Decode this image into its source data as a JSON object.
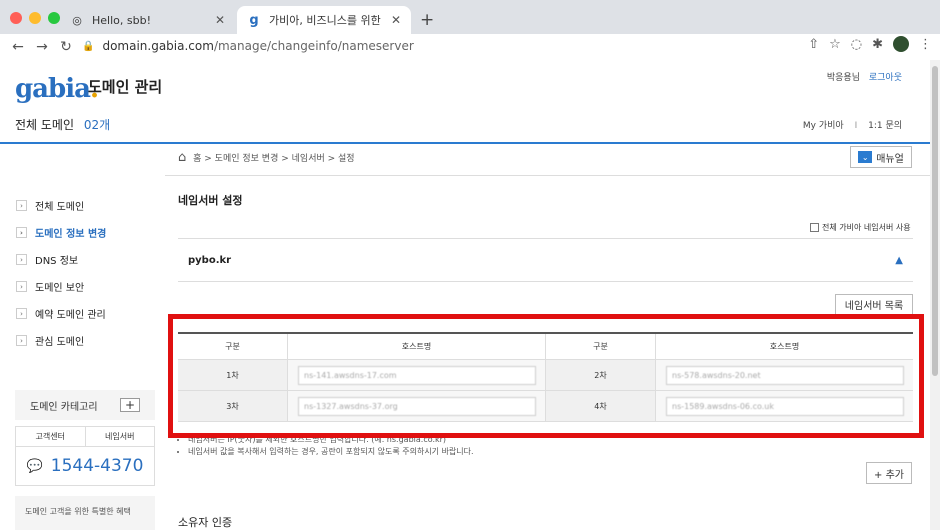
{
  "browser": {
    "tabs": [
      {
        "title": "Hello, sbb!",
        "active": false
      },
      {
        "title": "가비아, 비즈니스를 위한 IT : 도메인/",
        "active": true
      }
    ],
    "url_domain": "domain.gabia.com",
    "url_path": "/manage/changeinfo/nameserver"
  },
  "header": {
    "logo": "gabia",
    "logo_dot": ".",
    "site_title": "도메인 관리",
    "user_name": "박응용님",
    "logout": "로그아웃",
    "domains_label": "전체 도메인",
    "domains_count": "02개",
    "my_gabia": "My 가비아",
    "inquiry": "1:1 문의",
    "separator": "I"
  },
  "breadcrumb": {
    "items": "홈 > 도메인 정보 변경 > 네임서버 > 설정",
    "manual_label": "매뉴얼"
  },
  "sidebar": {
    "items": [
      {
        "label": "전체 도메인",
        "active": false
      },
      {
        "label": "도메인 정보 변경",
        "active": true
      },
      {
        "label": "DNS 정보",
        "active": false
      },
      {
        "label": "도메인 보안",
        "active": false
      },
      {
        "label": "예약 도메인 관리",
        "active": false
      },
      {
        "label": "관심 도메인",
        "active": false
      }
    ],
    "category_label": "도메인 카테고리",
    "category_add": "+",
    "support_tab1": "고객센터",
    "support_tab2": "네임서버",
    "phone": "1544-4370",
    "promo": "도메인 고객을 위한 특별한 혜택"
  },
  "main": {
    "title": "네임서버 설정",
    "check_all_label": "전체 가비아 네임서버 사용",
    "domain_name": "pybo.kr",
    "ns_list_button": "네임서버 목록",
    "table": {
      "headers": [
        "구분",
        "호스트명",
        "구분",
        "호스트명"
      ],
      "rows": [
        {
          "left_label": "1차",
          "left_value": "ns-141.awsdns-17.com",
          "right_label": "2차",
          "right_value": "ns-578.awsdns-20.net"
        },
        {
          "left_label": "3차",
          "left_value": "ns-1327.awsdns-37.org",
          "right_label": "4차",
          "right_value": "ns-1589.awsdns-06.co.uk"
        }
      ]
    },
    "notes": [
      "네임서버는 IP(숫자)를 제외한 호스트명만 입력합니다. (예. ns.gabia.co.kr)",
      "네임서버 값을 복사해서 입력하는 경우, 공란이 포함되지 않도록 주의하시기 바랍니다."
    ],
    "add_button": "+ 추가",
    "owner_title": "소유자 인증"
  },
  "colors": {
    "accent": "#2a7bd0",
    "highlight": "#e01010"
  }
}
